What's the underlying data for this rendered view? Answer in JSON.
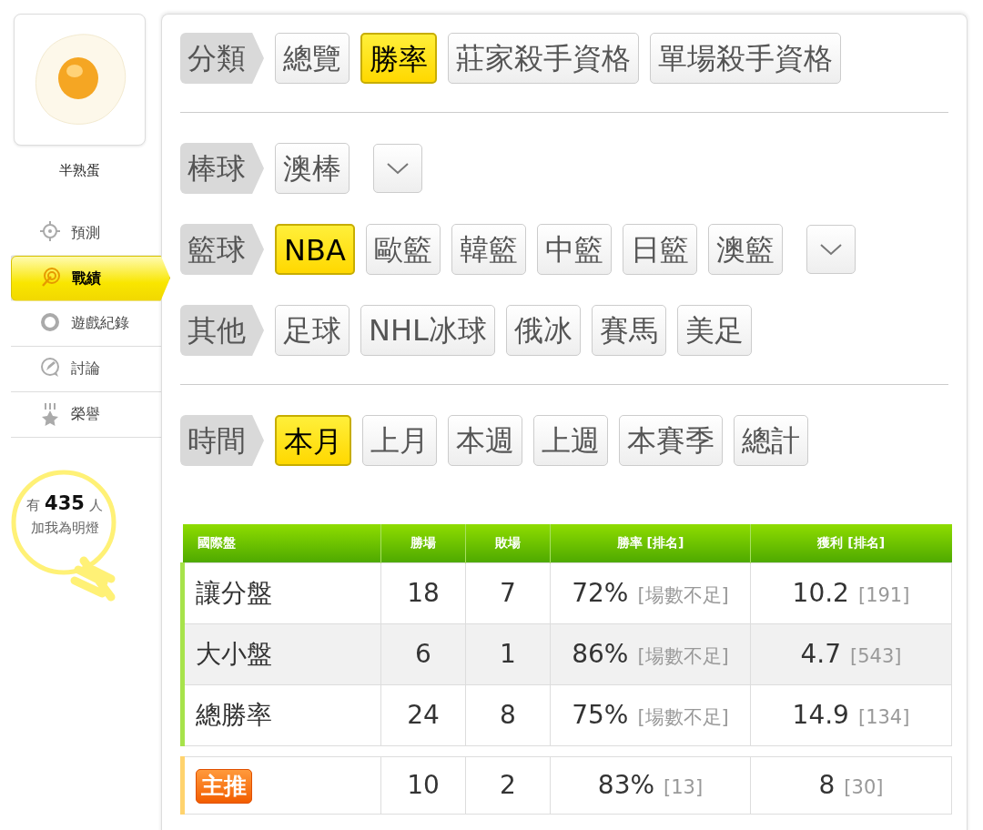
{
  "profile": {
    "name": "半熟蛋"
  },
  "nav": [
    {
      "label": "預測",
      "selected": false
    },
    {
      "label": "戰績",
      "selected": true
    },
    {
      "label": "遊戲紀錄",
      "selected": false
    },
    {
      "label": "討論",
      "selected": false
    },
    {
      "label": "榮譽",
      "selected": false
    }
  ],
  "fans": {
    "prefix": "有",
    "count": "435",
    "suffix": "人",
    "caption": "加我為明燈"
  },
  "filter_sections": [
    [
      {
        "label": "分類",
        "has_dropdown": false,
        "options": [
          {
            "label": "總覽",
            "selected": false
          },
          {
            "label": "勝率",
            "selected": true
          },
          {
            "label": "莊家殺手資格",
            "selected": false
          },
          {
            "label": "單場殺手資格",
            "selected": false
          }
        ]
      }
    ],
    [
      {
        "label": "棒球",
        "has_dropdown": true,
        "options": [
          {
            "label": "澳棒",
            "selected": false
          }
        ]
      },
      {
        "label": "籃球",
        "has_dropdown": true,
        "options": [
          {
            "label": "NBA",
            "selected": true
          },
          {
            "label": "歐籃",
            "selected": false
          },
          {
            "label": "韓籃",
            "selected": false
          },
          {
            "label": "中籃",
            "selected": false
          },
          {
            "label": "日籃",
            "selected": false
          },
          {
            "label": "澳籃",
            "selected": false
          }
        ]
      },
      {
        "label": "其他",
        "has_dropdown": false,
        "options": [
          {
            "label": "足球",
            "selected": false
          },
          {
            "label": "NHL冰球",
            "selected": false
          },
          {
            "label": "俄冰",
            "selected": false
          },
          {
            "label": "賽馬",
            "selected": false
          },
          {
            "label": "美足",
            "selected": false
          }
        ]
      }
    ],
    [
      {
        "label": "時間",
        "has_dropdown": false,
        "options": [
          {
            "label": "本月",
            "selected": true
          },
          {
            "label": "上月",
            "selected": false
          },
          {
            "label": "本週",
            "selected": false
          },
          {
            "label": "上週",
            "selected": false
          },
          {
            "label": "本賽季",
            "selected": false
          },
          {
            "label": "總計",
            "selected": false
          }
        ]
      }
    ]
  ],
  "table": {
    "columns": [
      "國際盤",
      "勝場",
      "敗場",
      "勝率 [排名]",
      "獲利 [排名]"
    ],
    "rows": [
      {
        "kind": "normal",
        "name": "讓分盤",
        "wins": "18",
        "losses": "7",
        "rate": "72%",
        "rate_rank": "[場數不足]",
        "profit": "10.2",
        "profit_rank": "[191]"
      },
      {
        "kind": "normal",
        "name": "大小盤",
        "wins": "6",
        "losses": "1",
        "rate": "86%",
        "rate_rank": "[場數不足]",
        "profit": "4.7",
        "profit_rank": "[543]"
      },
      {
        "kind": "normal",
        "name": "總勝率",
        "wins": "24",
        "losses": "8",
        "rate": "75%",
        "rate_rank": "[場數不足]",
        "profit": "14.9",
        "profit_rank": "[134]"
      },
      {
        "kind": "featured",
        "name": "主推",
        "wins": "10",
        "losses": "2",
        "rate": "83%",
        "rate_rank": "[13]",
        "profit": "8",
        "profit_rank": "[30]"
      }
    ]
  }
}
